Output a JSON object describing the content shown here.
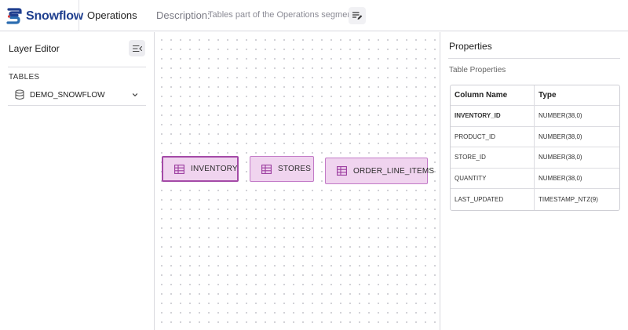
{
  "header": {
    "brand": "Snowflow",
    "segment_title": "Operations",
    "description_label": "Description:",
    "description_value": "Tables part of the Operations segment"
  },
  "left_panel": {
    "title": "Layer Editor",
    "tables_label": "TABLES",
    "databases": [
      {
        "name": "DEMO_SNOWFLOW",
        "expanded": false
      }
    ]
  },
  "canvas": {
    "nodes": [
      {
        "label": "INVENTORY",
        "selected": true
      },
      {
        "label": "STORES",
        "selected": false
      },
      {
        "label": "ORDER_LINE_ITEMS",
        "selected": false
      }
    ]
  },
  "properties": {
    "title": "Properties",
    "subtitle": "Table Properties",
    "columns": [
      "Column Name",
      "Type"
    ],
    "rows": [
      {
        "name": "INVENTORY_ID",
        "type": "NUMBER(38,0)"
      },
      {
        "name": "PRODUCT_ID",
        "type": "NUMBER(38,0)"
      },
      {
        "name": "STORE_ID",
        "type": "NUMBER(38,0)"
      },
      {
        "name": "QUANTITY",
        "type": "NUMBER(38,0)"
      },
      {
        "name": "LAST_UPDATED",
        "type": "TIMESTAMP_NTZ(9)"
      }
    ]
  },
  "colors": {
    "brand_blue": "#1f3f8f",
    "brand_accent": "#2b6cb0",
    "node_fill": "#f0d4ef",
    "node_border": "#c27ac7",
    "node_selected_border": "#a44aa7"
  }
}
